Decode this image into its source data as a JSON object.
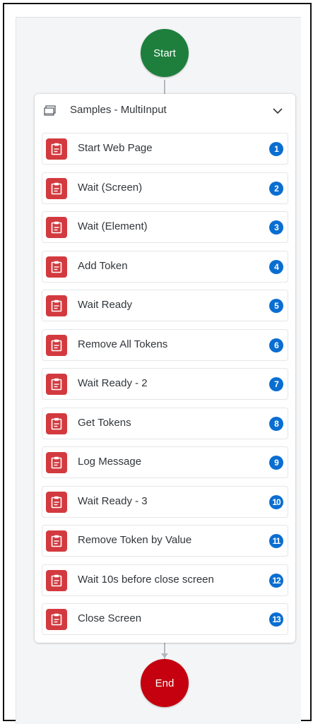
{
  "flow": {
    "start_label": "Start",
    "end_label": "End",
    "group": {
      "title": "Samples - MultiInput",
      "steps": [
        {
          "label": "Start Web Page",
          "number": "1"
        },
        {
          "label": "Wait (Screen)",
          "number": "2"
        },
        {
          "label": "Wait (Element)",
          "number": "3"
        },
        {
          "label": "Add Token",
          "number": "4"
        },
        {
          "label": "Wait Ready",
          "number": "5"
        },
        {
          "label": "Remove All Tokens",
          "number": "6"
        },
        {
          "label": "Wait Ready - 2",
          "number": "7"
        },
        {
          "label": "Get Tokens",
          "number": "8"
        },
        {
          "label": "Log Message",
          "number": "9"
        },
        {
          "label": "Wait Ready - 3",
          "number": "10"
        },
        {
          "label": "Remove Token by Value",
          "number": "11"
        },
        {
          "label": "Wait 10s before close screen",
          "number": "12"
        },
        {
          "label": "Close Screen",
          "number": "13"
        }
      ]
    }
  },
  "colors": {
    "start": "#1e7f3d",
    "end": "#c5000f",
    "step_icon": "#d33a3f",
    "badge": "#0a6ed1"
  },
  "icons": {
    "group": "screen-icon",
    "collapse": "chevron-down-icon",
    "step": "clipboard-icon"
  }
}
